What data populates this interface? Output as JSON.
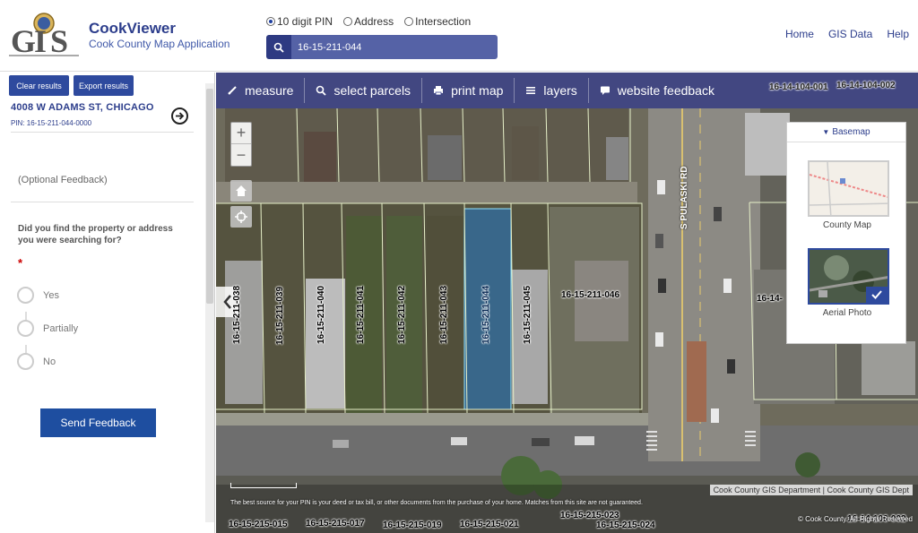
{
  "header": {
    "app_title": "CookViewer",
    "app_subtitle": "Cook County Map Application",
    "search_options": [
      {
        "label": "10 digit PIN",
        "selected": true
      },
      {
        "label": "Address",
        "selected": false
      },
      {
        "label": "Intersection",
        "selected": false
      }
    ],
    "search_value": "16-15-211-044",
    "nav": [
      "Home",
      "GIS Data",
      "Help"
    ]
  },
  "left_panel": {
    "clear_label": "Clear results",
    "export_label": "Export results",
    "address": "4008 W ADAMS ST, CHICAGO",
    "pin": "PIN: 16-15-211-044-0000",
    "feedback_placeholder": "(Optional Feedback)",
    "question": "Did you find the property or address you were searching for?",
    "required_mark": "*",
    "choices": [
      "Yes",
      "Partially",
      "No"
    ],
    "send_label": "Send Feedback"
  },
  "map": {
    "tools": [
      "measure",
      "select parcels",
      "print map",
      "layers",
      "website feedback"
    ],
    "basemap": {
      "title": "Basemap",
      "options": [
        {
          "label": "County Map",
          "selected": false
        },
        {
          "label": "Aerial Photo",
          "selected": true
        }
      ]
    },
    "parcels": [
      "16-15-211-038",
      "16-15-211-039",
      "16-15-211-040",
      "16-15-211-041",
      "16-15-211-042",
      "16-15-211-043",
      "16-15-211-044",
      "16-15-211-045",
      "16-15-211-046",
      "16-14-"
    ],
    "bottom_parcels": [
      "16-15-215-015",
      "16-15-215-017",
      "16-15-215-019",
      "16-15-215-021",
      "16-15-215-023",
      "16-15-215-024"
    ],
    "top_parcels": [
      "16-14-104-001",
      "16-14-104-002"
    ],
    "right_parcels": [
      "16-14-106-002"
    ],
    "street": "S PULASKI RD",
    "disclaimer": "The best source for your PIN is your deed or tax bill, or other documents from the purchase of your home. Matches from this site are not guaranteed.",
    "attribution": "Cook County GIS Department | Cook County GIS Dept",
    "copyright": "© Cook County. All Rights Reserved"
  },
  "colors": {
    "brand": "#2d3e8c",
    "button": "#2e4a9e",
    "selected_parcel": "#2f6fa8"
  }
}
